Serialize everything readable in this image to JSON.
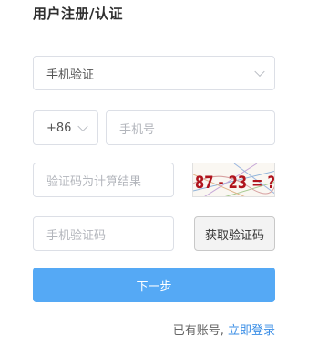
{
  "title": "用户注册/认证",
  "form": {
    "method_select": {
      "value": "手机验证"
    },
    "country_code": {
      "value": "+86"
    },
    "phone": {
      "placeholder": "手机号"
    },
    "captcha_input": {
      "placeholder": "验证码为计算结果"
    },
    "captcha_image": {
      "text": "87 - 23 = ?"
    },
    "sms_code": {
      "placeholder": "手机验证码"
    },
    "get_code_button": "获取验证码",
    "next_button": "下一步"
  },
  "footer": {
    "prompt": "已有账号,",
    "login_link": "立即登录"
  },
  "colors": {
    "primary": "#55a9f5",
    "link": "#3a8ee6",
    "captcha_text": "#b0141d"
  }
}
